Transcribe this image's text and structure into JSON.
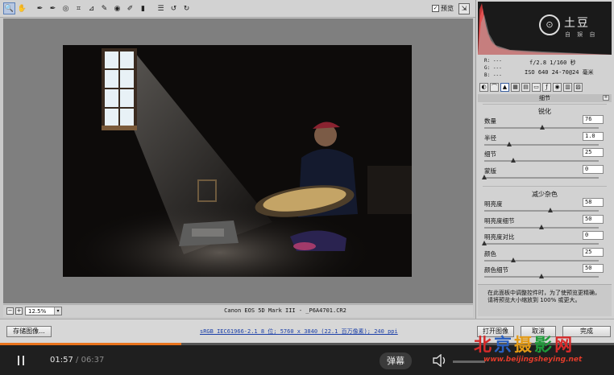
{
  "toolbar": {
    "tools": [
      {
        "name": "zoom-tool",
        "glyph": "🔍"
      },
      {
        "name": "hand-tool",
        "glyph": "✋"
      },
      {
        "name": "white-balance-tool",
        "glyph": "✒"
      },
      {
        "name": "color-sampler-tool",
        "glyph": "✒"
      },
      {
        "name": "target-adjust-tool",
        "glyph": "◎"
      },
      {
        "name": "crop-tool",
        "glyph": "⌗"
      },
      {
        "name": "straighten-tool",
        "glyph": "⊿"
      },
      {
        "name": "spot-removal-tool",
        "glyph": "✎"
      },
      {
        "name": "red-eye-tool",
        "glyph": "◉"
      },
      {
        "name": "adjustment-brush-tool",
        "glyph": "✐"
      },
      {
        "name": "graduated-filter-tool",
        "glyph": "▮"
      },
      {
        "name": "preferences-tool",
        "glyph": "☰"
      },
      {
        "name": "rotate-left-tool",
        "glyph": "↺"
      },
      {
        "name": "rotate-right-tool",
        "glyph": "↻"
      }
    ],
    "preview_label": "预览",
    "preview_checked": "✓"
  },
  "histogram": {
    "logo_badge": "⊙",
    "logo_text": "土豆",
    "logo_sub": "自 娱 自"
  },
  "meta": {
    "r_label": "R:",
    "g_label": "G:",
    "b_label": "B:",
    "dash": "---",
    "aperture_shutter": "f/2.8  1/160 秒",
    "iso_lens": "ISO 640  24-70@24 毫米"
  },
  "panel": {
    "section_title": "细节",
    "sharpen_title": "锐化",
    "noise_title": "减少杂色",
    "sharpen": [
      {
        "label": "数量",
        "value": "76",
        "pos": 0.51
      },
      {
        "label": "半径",
        "value": "1.0",
        "pos": 0.22
      },
      {
        "label": "细节",
        "value": "25",
        "pos": 0.25
      },
      {
        "label": "蒙版",
        "value": "0",
        "pos": 0.0
      }
    ],
    "noise": [
      {
        "label": "明亮度",
        "value": "58",
        "pos": 0.58
      },
      {
        "label": "明亮度细节",
        "value": "50",
        "pos": 0.5
      },
      {
        "label": "明亮度对比",
        "value": "0",
        "pos": 0.0
      },
      {
        "label": "颜色",
        "value": "25",
        "pos": 0.25
      },
      {
        "label": "颜色细节",
        "value": "50",
        "pos": 0.5
      }
    ],
    "tip_line1": "在此面板中调整控件时，为了使预览更精确，",
    "tip_line2": "请将预览大小缩放到 100% 或更大。"
  },
  "status": {
    "zoom_value": "12.5%",
    "file_info": "Canon EOS 5D Mark III - _P6A4701.CR2"
  },
  "bottom": {
    "save_label": "存储图像...",
    "workflow_link": "sRGB IEC61966-2.1 8 位; 5760 x 3840 (22.1 百万像素); 240 ppi",
    "open_label": "打开图像",
    "cancel_label": "取消",
    "done_label": "完成"
  },
  "player": {
    "current_time": "01:57",
    "total_time": "06:37",
    "danmu_label": "弹幕",
    "progress": 0.295
  },
  "watermark": {
    "title": "北京摄影网",
    "url": "www.beijingsheying.net"
  }
}
